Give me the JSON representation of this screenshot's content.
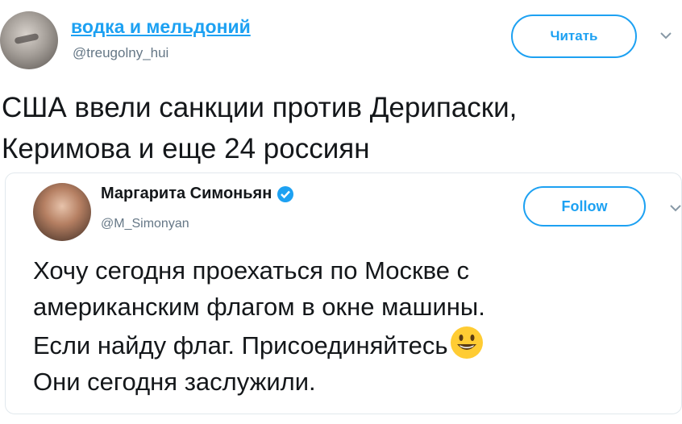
{
  "author": {
    "display_name": "водка и мельдоний",
    "handle": "@treugolny_hui",
    "follow_label": "Читать"
  },
  "tweet": {
    "text_line1": "США ввели санкции против Дерипаски,",
    "text_line2": "Керимова и еще 24 россиян"
  },
  "quoted": {
    "display_name": "Маргарита Симоньян",
    "handle": "@M_Simonyan",
    "follow_label": "Follow",
    "lines": [
      "Хочу сегодня проехаться по Москве с",
      "американским флагом в окне машины.",
      "Если найду флаг. Присоединяйтесь",
      "Они сегодня заслужили."
    ]
  },
  "colors": {
    "accent": "#1da1f2",
    "muted": "#657786",
    "text": "#14171a",
    "border": "#e1e8ed"
  },
  "icons": [
    "avatar",
    "chevron-down-icon",
    "verified-badge-icon",
    "smiley-emoji-icon"
  ]
}
